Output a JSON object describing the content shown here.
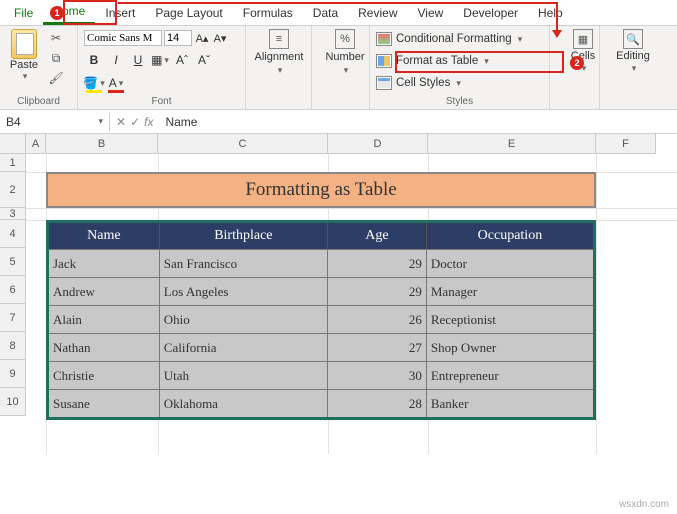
{
  "tabs": {
    "file": "File",
    "home": "Home",
    "insert": "Insert",
    "page_layout": "Page Layout",
    "formulas": "Formulas",
    "data": "Data",
    "review": "Review",
    "view": "View",
    "developer": "Developer",
    "help": "Help"
  },
  "ribbon": {
    "clipboard": {
      "paste": "Paste",
      "label": "Clipboard"
    },
    "font": {
      "name": "Comic Sans M",
      "size": "14",
      "bold": "B",
      "italic": "I",
      "underline": "U",
      "label": "Font"
    },
    "alignment": {
      "btn": "Alignment"
    },
    "number": {
      "btn": "Number",
      "symbol": "%"
    },
    "styles": {
      "conditional": "Conditional Formatting",
      "format_table": "Format as Table",
      "cell_styles": "Cell Styles",
      "label": "Styles"
    },
    "cells": {
      "btn": "Cells"
    },
    "editing": {
      "btn": "Editing"
    }
  },
  "callouts": {
    "one": "1",
    "two": "2"
  },
  "namebox": {
    "ref": "B4",
    "formula": "Name",
    "fx": "fx"
  },
  "columns": [
    "A",
    "B",
    "C",
    "D",
    "E",
    "F"
  ],
  "rows": [
    "1",
    "2",
    "3",
    "4",
    "5",
    "6",
    "7",
    "8",
    "9",
    "10"
  ],
  "title_cell": "Formatting as Table",
  "table": {
    "headers": {
      "name": "Name",
      "birth": "Birthplace",
      "age": "Age",
      "occ": "Occupation"
    },
    "rows": [
      {
        "name": "Jack",
        "birth": "San Francisco",
        "age": "29",
        "occ": "Doctor"
      },
      {
        "name": "Andrew",
        "birth": "Los Angeles",
        "age": "29",
        "occ": "Manager"
      },
      {
        "name": "Alain",
        "birth": "Ohio",
        "age": "26",
        "occ": "Receptionist"
      },
      {
        "name": "Nathan",
        "birth": "California",
        "age": "27",
        "occ": "Shop Owner"
      },
      {
        "name": "Christie",
        "birth": "Utah",
        "age": "30",
        "occ": "Entrepreneur"
      },
      {
        "name": "Susane",
        "birth": "Oklahoma",
        "age": "28",
        "occ": "Banker"
      }
    ]
  },
  "watermark": "wsxdn.com"
}
